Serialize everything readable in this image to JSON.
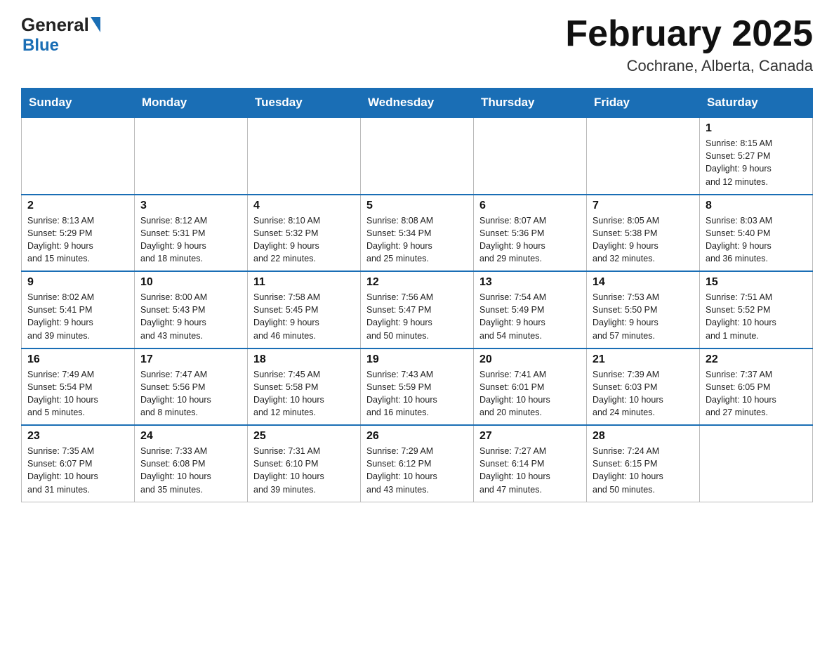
{
  "header": {
    "logo_general": "General",
    "logo_blue": "Blue",
    "title": "February 2025",
    "subtitle": "Cochrane, Alberta, Canada"
  },
  "days_of_week": [
    "Sunday",
    "Monday",
    "Tuesday",
    "Wednesday",
    "Thursday",
    "Friday",
    "Saturday"
  ],
  "weeks": [
    {
      "days": [
        {
          "date": "",
          "info": "",
          "empty": true
        },
        {
          "date": "",
          "info": "",
          "empty": true
        },
        {
          "date": "",
          "info": "",
          "empty": true
        },
        {
          "date": "",
          "info": "",
          "empty": true
        },
        {
          "date": "",
          "info": "",
          "empty": true
        },
        {
          "date": "",
          "info": "",
          "empty": true
        },
        {
          "date": "1",
          "info": "Sunrise: 8:15 AM\nSunset: 5:27 PM\nDaylight: 9 hours\nand 12 minutes.",
          "empty": false
        }
      ]
    },
    {
      "days": [
        {
          "date": "2",
          "info": "Sunrise: 8:13 AM\nSunset: 5:29 PM\nDaylight: 9 hours\nand 15 minutes.",
          "empty": false
        },
        {
          "date": "3",
          "info": "Sunrise: 8:12 AM\nSunset: 5:31 PM\nDaylight: 9 hours\nand 18 minutes.",
          "empty": false
        },
        {
          "date": "4",
          "info": "Sunrise: 8:10 AM\nSunset: 5:32 PM\nDaylight: 9 hours\nand 22 minutes.",
          "empty": false
        },
        {
          "date": "5",
          "info": "Sunrise: 8:08 AM\nSunset: 5:34 PM\nDaylight: 9 hours\nand 25 minutes.",
          "empty": false
        },
        {
          "date": "6",
          "info": "Sunrise: 8:07 AM\nSunset: 5:36 PM\nDaylight: 9 hours\nand 29 minutes.",
          "empty": false
        },
        {
          "date": "7",
          "info": "Sunrise: 8:05 AM\nSunset: 5:38 PM\nDaylight: 9 hours\nand 32 minutes.",
          "empty": false
        },
        {
          "date": "8",
          "info": "Sunrise: 8:03 AM\nSunset: 5:40 PM\nDaylight: 9 hours\nand 36 minutes.",
          "empty": false
        }
      ]
    },
    {
      "days": [
        {
          "date": "9",
          "info": "Sunrise: 8:02 AM\nSunset: 5:41 PM\nDaylight: 9 hours\nand 39 minutes.",
          "empty": false
        },
        {
          "date": "10",
          "info": "Sunrise: 8:00 AM\nSunset: 5:43 PM\nDaylight: 9 hours\nand 43 minutes.",
          "empty": false
        },
        {
          "date": "11",
          "info": "Sunrise: 7:58 AM\nSunset: 5:45 PM\nDaylight: 9 hours\nand 46 minutes.",
          "empty": false
        },
        {
          "date": "12",
          "info": "Sunrise: 7:56 AM\nSunset: 5:47 PM\nDaylight: 9 hours\nand 50 minutes.",
          "empty": false
        },
        {
          "date": "13",
          "info": "Sunrise: 7:54 AM\nSunset: 5:49 PM\nDaylight: 9 hours\nand 54 minutes.",
          "empty": false
        },
        {
          "date": "14",
          "info": "Sunrise: 7:53 AM\nSunset: 5:50 PM\nDaylight: 9 hours\nand 57 minutes.",
          "empty": false
        },
        {
          "date": "15",
          "info": "Sunrise: 7:51 AM\nSunset: 5:52 PM\nDaylight: 10 hours\nand 1 minute.",
          "empty": false
        }
      ]
    },
    {
      "days": [
        {
          "date": "16",
          "info": "Sunrise: 7:49 AM\nSunset: 5:54 PM\nDaylight: 10 hours\nand 5 minutes.",
          "empty": false
        },
        {
          "date": "17",
          "info": "Sunrise: 7:47 AM\nSunset: 5:56 PM\nDaylight: 10 hours\nand 8 minutes.",
          "empty": false
        },
        {
          "date": "18",
          "info": "Sunrise: 7:45 AM\nSunset: 5:58 PM\nDaylight: 10 hours\nand 12 minutes.",
          "empty": false
        },
        {
          "date": "19",
          "info": "Sunrise: 7:43 AM\nSunset: 5:59 PM\nDaylight: 10 hours\nand 16 minutes.",
          "empty": false
        },
        {
          "date": "20",
          "info": "Sunrise: 7:41 AM\nSunset: 6:01 PM\nDaylight: 10 hours\nand 20 minutes.",
          "empty": false
        },
        {
          "date": "21",
          "info": "Sunrise: 7:39 AM\nSunset: 6:03 PM\nDaylight: 10 hours\nand 24 minutes.",
          "empty": false
        },
        {
          "date": "22",
          "info": "Sunrise: 7:37 AM\nSunset: 6:05 PM\nDaylight: 10 hours\nand 27 minutes.",
          "empty": false
        }
      ]
    },
    {
      "days": [
        {
          "date": "23",
          "info": "Sunrise: 7:35 AM\nSunset: 6:07 PM\nDaylight: 10 hours\nand 31 minutes.",
          "empty": false
        },
        {
          "date": "24",
          "info": "Sunrise: 7:33 AM\nSunset: 6:08 PM\nDaylight: 10 hours\nand 35 minutes.",
          "empty": false
        },
        {
          "date": "25",
          "info": "Sunrise: 7:31 AM\nSunset: 6:10 PM\nDaylight: 10 hours\nand 39 minutes.",
          "empty": false
        },
        {
          "date": "26",
          "info": "Sunrise: 7:29 AM\nSunset: 6:12 PM\nDaylight: 10 hours\nand 43 minutes.",
          "empty": false
        },
        {
          "date": "27",
          "info": "Sunrise: 7:27 AM\nSunset: 6:14 PM\nDaylight: 10 hours\nand 47 minutes.",
          "empty": false
        },
        {
          "date": "28",
          "info": "Sunrise: 7:24 AM\nSunset: 6:15 PM\nDaylight: 10 hours\nand 50 minutes.",
          "empty": false
        },
        {
          "date": "",
          "info": "",
          "empty": true
        }
      ]
    }
  ]
}
